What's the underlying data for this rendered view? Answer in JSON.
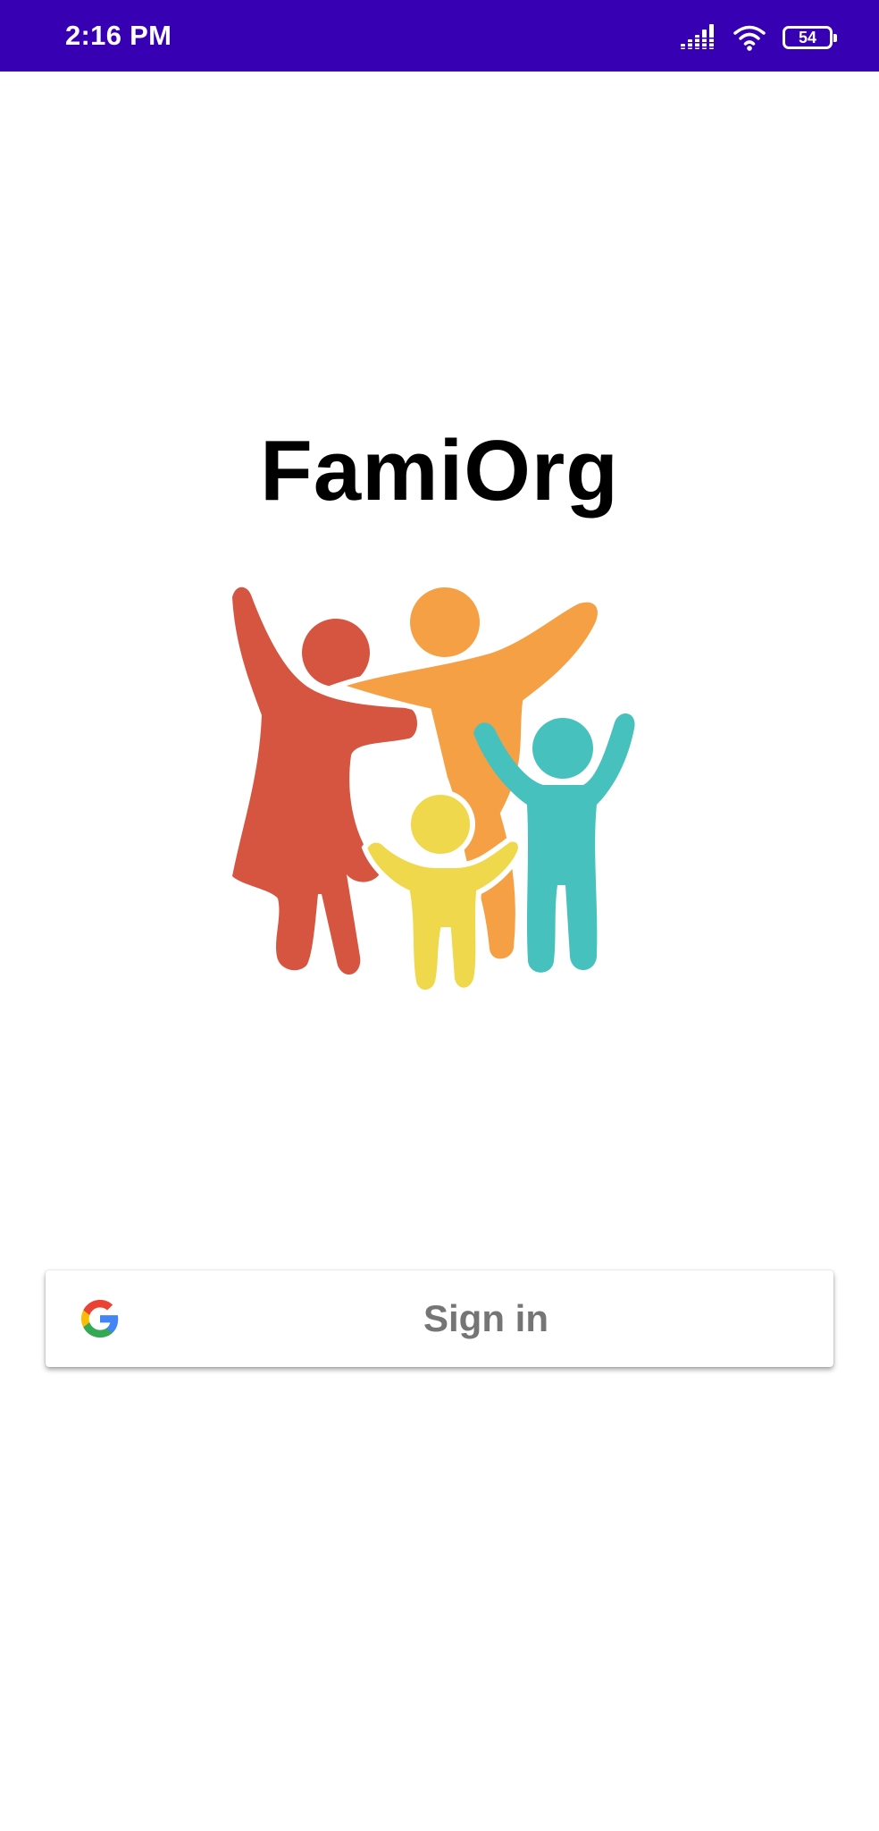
{
  "status_bar": {
    "time": "2:16 PM",
    "battery_level": "54",
    "background_color": "#3700b3",
    "icons": [
      "signal-icon",
      "wifi-icon",
      "battery-icon"
    ]
  },
  "app": {
    "title": "FamiOrg",
    "logo_icon": "family-logo",
    "logo_colors": [
      "#d65540",
      "#f5a045",
      "#47c1bd",
      "#efd84b"
    ]
  },
  "signin": {
    "label": "Sign in",
    "icon": "google-icon"
  }
}
